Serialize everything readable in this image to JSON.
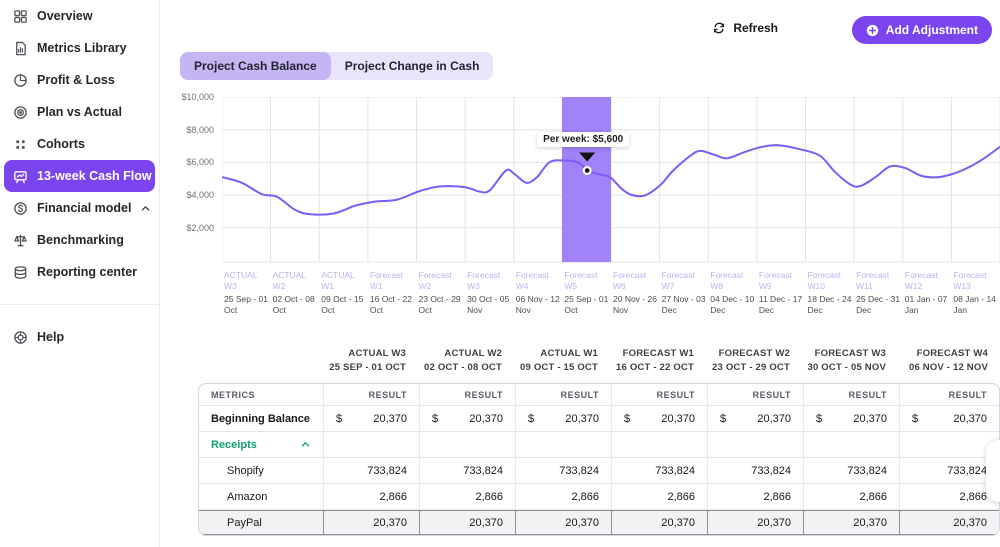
{
  "sidebar": {
    "items": [
      {
        "label": "Overview",
        "icon": "grid"
      },
      {
        "label": "Metrics Library",
        "icon": "document"
      },
      {
        "label": "Profit & Loss",
        "icon": "pie"
      },
      {
        "label": "Plan vs Actual",
        "icon": "target"
      },
      {
        "label": "Cohorts",
        "icon": "dots-grid"
      },
      {
        "label": "13-week Cash Flow",
        "icon": "board-chart",
        "selected": true
      },
      {
        "label": "Financial model",
        "icon": "dollar-circle",
        "chevron": "up"
      },
      {
        "label": "Benchmarking",
        "icon": "scales"
      },
      {
        "label": "Reporting center",
        "icon": "stack"
      }
    ],
    "help": {
      "label": "Help",
      "icon": "help-ring"
    }
  },
  "toolbar": {
    "refresh_label": "Refresh",
    "add_adjustment_label": "Add Adjustment"
  },
  "tabs": [
    {
      "label": "Project Cash Balance",
      "active": true
    },
    {
      "label": "Project Change in Cash",
      "active": false
    }
  ],
  "colors": {
    "accent": "#7a44ee",
    "band": "#a182f8",
    "line": "#7c5cfa",
    "grid": "#e4e4e7",
    "green": "#0e9f6e",
    "axis_week_name": "#b7b3f2"
  },
  "chart_data": {
    "type": "line",
    "title": "Project Cash Balance",
    "grid": true,
    "ylim": [
      0,
      10000
    ],
    "yticks": [
      10000,
      8000,
      6000,
      4000,
      2000
    ],
    "ytick_labels": [
      "$10,000",
      "$8,000",
      "$6,000",
      "$4,000",
      "$2,000"
    ],
    "weeks": [
      {
        "name": "ACTUAL W3",
        "dates": "25 Sep - 01 Oct"
      },
      {
        "name": "ACTUAL W2",
        "dates": "02 Oct - 08 Oct"
      },
      {
        "name": "ACTUAL W1",
        "dates": "09 Oct - 15 Oct"
      },
      {
        "name": "Forecast W1",
        "dates": "16 Oct - 22 Oct"
      },
      {
        "name": "Forecast W2",
        "dates": "23 Oct - 29 Oct"
      },
      {
        "name": "Forecast W3",
        "dates": "30 Oct - 05 Nov"
      },
      {
        "name": "Forecast W4",
        "dates": "06 Nov - 12 Nov"
      },
      {
        "name": "Forecast W5",
        "dates": "25 Sep - 01 Oct"
      },
      {
        "name": "Forecast W6",
        "dates": "20 Nov - 26 Nov"
      },
      {
        "name": "Forecast W7",
        "dates": "27 Nov - 03 Dec"
      },
      {
        "name": "Forecast W8",
        "dates": "04 Dec - 10 Dec"
      },
      {
        "name": "Forecast W9",
        "dates": "11 Dec - 17 Dec"
      },
      {
        "name": "Forecast W10",
        "dates": "18 Dec - 24 Dec"
      },
      {
        "name": "Forecast W11",
        "dates": "25 Dec - 31 Dec"
      },
      {
        "name": "Forecast W12",
        "dates": "01 Jan - 07 Jan"
      },
      {
        "name": "Forecast W13",
        "dates": "08 Jan - 14 Jan"
      }
    ],
    "highlight": {
      "week_name": "Forecast W5",
      "week_start_index": 7,
      "week_end_index": 8
    },
    "tooltip": {
      "text": "Per week: $5,600",
      "value": 5600,
      "anchor_week": 7.51,
      "anchor_value": 5500
    },
    "points_week_vs_dollars": [
      [
        0.0,
        5100
      ],
      [
        0.41,
        4750
      ],
      [
        0.82,
        4050
      ],
      [
        1.13,
        3900
      ],
      [
        1.5,
        3100
      ],
      [
        1.81,
        2830
      ],
      [
        2.3,
        2870
      ],
      [
        2.74,
        3350
      ],
      [
        3.15,
        3600
      ],
      [
        3.6,
        3720
      ],
      [
        4.07,
        4250
      ],
      [
        4.49,
        4530
      ],
      [
        5.0,
        4480
      ],
      [
        5.31,
        4200
      ],
      [
        5.51,
        4300
      ],
      [
        5.84,
        5500
      ],
      [
        6.01,
        5300
      ],
      [
        6.26,
        4750
      ],
      [
        6.48,
        5100
      ],
      [
        6.73,
        6000
      ],
      [
        7.0,
        6120
      ],
      [
        7.33,
        6000
      ],
      [
        7.51,
        5500
      ],
      [
        7.78,
        5250
      ],
      [
        7.98,
        5100
      ],
      [
        8.23,
        4350
      ],
      [
        8.44,
        4000
      ],
      [
        8.7,
        3980
      ],
      [
        9.01,
        4600
      ],
      [
        9.28,
        5500
      ],
      [
        9.63,
        6400
      ],
      [
        9.84,
        6700
      ],
      [
        10.14,
        6450
      ],
      [
        10.39,
        6250
      ],
      [
        10.76,
        6650
      ],
      [
        11.11,
        6950
      ],
      [
        11.44,
        7050
      ],
      [
        11.89,
        6800
      ],
      [
        12.3,
        6400
      ],
      [
        12.61,
        5400
      ],
      [
        12.92,
        4650
      ],
      [
        13.13,
        4550
      ],
      [
        13.44,
        5100
      ],
      [
        13.74,
        5750
      ],
      [
        14.05,
        5650
      ],
      [
        14.36,
        5200
      ],
      [
        14.67,
        5080
      ],
      [
        14.98,
        5250
      ],
      [
        15.29,
        5600
      ],
      [
        15.6,
        6100
      ],
      [
        16.0,
        6950
      ]
    ]
  },
  "table": {
    "metrics_header": "METRICS",
    "result_header": "RESULT",
    "columns": [
      {
        "name": "ACTUAL W3",
        "dates": "25 SEP - 01 OCT"
      },
      {
        "name": "ACTUAL W2",
        "dates": "02 OCT - 08 OCT"
      },
      {
        "name": "ACTUAL W1",
        "dates": "09 OCT - 15 OCT"
      },
      {
        "name": "FORECAST W1",
        "dates": "16 OCT - 22 OCT"
      },
      {
        "name": "FORECAST W2",
        "dates": "23 OCT - 29 OCT"
      },
      {
        "name": "FORECAST W3",
        "dates": "30 OCT - 05 NOV"
      },
      {
        "name": "FORECAST W4",
        "dates": "06 NOV - 12 NOV"
      }
    ],
    "rows": [
      {
        "label": "Beginning Balance",
        "type": "balance",
        "currency": "$",
        "values": [
          "20,370",
          "20,370",
          "20,370",
          "20,370",
          "20,370",
          "20,370",
          "20,370"
        ]
      },
      {
        "label": "Receipts",
        "type": "group",
        "chevron": "up",
        "values": [
          "",
          "",
          "",
          "",
          "",
          "",
          ""
        ]
      },
      {
        "label": "Shopify",
        "type": "sub",
        "values": [
          "733,824",
          "733,824",
          "733,824",
          "733,824",
          "733,824",
          "733,824",
          "733,824"
        ]
      },
      {
        "label": "Amazon",
        "type": "sub",
        "values": [
          "2,866",
          "2,866",
          "2,866",
          "2,866",
          "2,866",
          "2,866",
          "2,866"
        ]
      },
      {
        "label": "PayPal",
        "type": "sub",
        "selected": true,
        "values": [
          "20,370",
          "20,370",
          "20,370",
          "20,370",
          "20,370",
          "20,370",
          "20,370"
        ]
      }
    ]
  }
}
